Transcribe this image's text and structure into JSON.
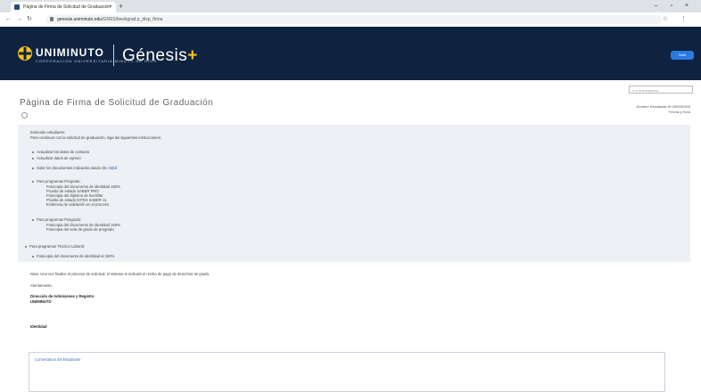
{
  "browser": {
    "tab_title": "Página de Firma de Solicitud de Graduación",
    "tab_close": "×",
    "new_tab": "+",
    "window_controls": "–  ▫  ×",
    "address_domain": "genesis.uniminuto.edu",
    "address_path": "/GNSS/bwskgrad.p_disp_firma",
    "right_icons": "☆  ⋮"
  },
  "header": {
    "logo_text": "UNIMINUTO",
    "logo_sub": "CORPORACIÓN UNIVERSITARIA MINUTO DE DIOS",
    "app_name": "Génesis",
    "app_plus": "+",
    "button_label": "Salir"
  },
  "page": {
    "search_placeholder": "Ir a la búsqueda...",
    "title": "Página de Firma de Solicitud de Graduación",
    "meta_line1": "Nombre Estudiante  ID 000000000",
    "meta_line2": "Fecha y Hora"
  },
  "instructions": {
    "greeting": "Estimado estudiante:",
    "intro": "Para continuar con la solicitud de graduación, siga las siguientes instrucciones:",
    "items_a": [
      "Actualizar los datos de contacto",
      "Actualizar datos de egreso"
    ],
    "docs_text": "Subir los documentos indicados dando clic",
    "docs_link": "AQUÍ",
    "pregrado_title": "Para programas Pregrado:",
    "pregrado_items": [
      "Fotocopia del documento de identidad 150%",
      "Prueba de estado SABER PRO",
      "Fotocopia del diploma de bachiller",
      "Prueba de estado ICFES SABER 11",
      "Evidencia de validación en el proceso"
    ],
    "posgrado_title": "Para programas Posgrado:",
    "posgrado_items": [
      "Fotocopia del documento de identidad 150%",
      "Fotocopia del acta de grado de pregrado"
    ],
    "tecnico_title": "Para programas Técnico Laboral:",
    "tecnico_items": [
      "Fotocopia del documento de identidad al 150%"
    ],
    "note": "Nota: Una vez finalice el proceso de solicitud, el sistema le indicará el recibo de pago de derechos de grado.",
    "regards": "Atentamente,",
    "sign1": "Dirección de Admisiones y Registro",
    "sign2": "UNIMINUTO",
    "signature_label": "Identidad"
  },
  "comments": {
    "label": "Comentarios del Estudiante"
  }
}
